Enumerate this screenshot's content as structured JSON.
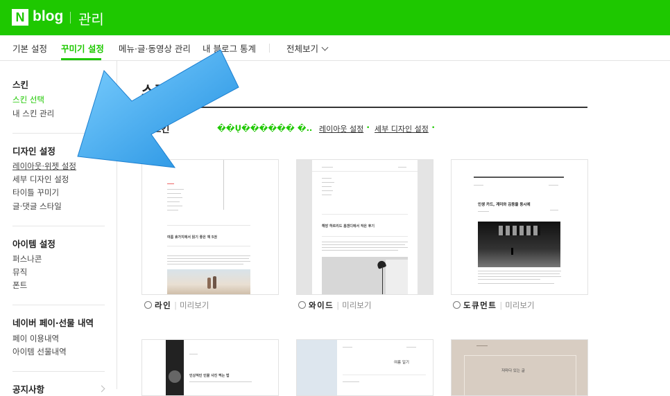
{
  "header": {
    "logo_mark": "N",
    "logo_text": "blog",
    "title": "관리"
  },
  "nav": {
    "items": [
      "기본 설정",
      "꾸미기 설정",
      "메뉴·글·동영상 관리",
      "내 블로그 통계",
      "전체보기"
    ],
    "active_index": 1
  },
  "sidebar": {
    "sections": [
      {
        "title": "스킨",
        "items": [
          "스킨 선택",
          "내 스킨 관리"
        ]
      },
      {
        "title": "디자인 설정",
        "items": [
          "레이아웃·위젯 설정",
          "세부 디자인 설정",
          "타이틀 꾸미기",
          "글·댓글 스타일"
        ]
      },
      {
        "title": "아이템 설정",
        "items": [
          "퍼스나콘",
          "뮤직",
          "폰트"
        ]
      },
      {
        "title": "네이버 페이·선물 내역",
        "items": [
          "페이 이용내역",
          "아이템 선물내역"
        ]
      },
      {
        "title": "공지사항",
        "items": []
      }
    ]
  },
  "main": {
    "title": "스킨",
    "current_label": "인 스킨",
    "current_skin_name": "��Ų������ �..",
    "links": [
      "레이아웃 설정",
      "세부 디자인 설정"
    ],
    "cards": [
      {
        "name": "라인",
        "preview": "미리보기",
        "sample_title": "여름 휴가지에서 읽기 좋은 책 5권"
      },
      {
        "name": "와이드",
        "preview": "미리보기",
        "sample_title": "해방 하르리드 홈갠디에서 작은 후기"
      },
      {
        "name": "도큐먼트",
        "preview": "미리보기",
        "sample_title": "인생 카드, 계미와 김동을 동시에"
      },
      {
        "name": "",
        "preview": "",
        "sample_title": "인상적인 인물 사진 찍는 법"
      },
      {
        "name": "",
        "preview": "",
        "sample_title": "여름 일기"
      },
      {
        "name": "",
        "preview": "",
        "sample_title": "저마다 있는 글"
      }
    ]
  },
  "colors": {
    "brand": "#1ec800",
    "arrow": "#2aa6f0"
  }
}
